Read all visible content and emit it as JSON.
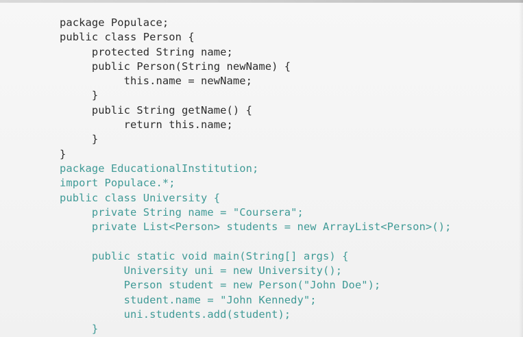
{
  "slide": {
    "code_lines": [
      {
        "text": "package Populace;",
        "color": "#2c2c2c"
      },
      {
        "text": "public class Person {",
        "color": "#2c2c2c"
      },
      {
        "text": "     protected String name;",
        "color": "#2c2c2c"
      },
      {
        "text": "     public Person(String newName) {",
        "color": "#2c2c2c"
      },
      {
        "text": "          this.name = newName;",
        "color": "#2c2c2c"
      },
      {
        "text": "     }",
        "color": "#2c2c2c"
      },
      {
        "text": "     public String getName() {",
        "color": "#2c2c2c"
      },
      {
        "text": "          return this.name;",
        "color": "#2c2c2c"
      },
      {
        "text": "     }",
        "color": "#2c2c2c"
      },
      {
        "text": "}",
        "color": "#2c2c2c"
      },
      {
        "text": "package EducationalInstitution;",
        "color": "#3f9a96"
      },
      {
        "text": "import Populace.*;",
        "color": "#3f9a96"
      },
      {
        "text": "public class University {",
        "color": "#3f9a96"
      },
      {
        "text": "     private String name = \"Coursera\";",
        "color": "#3f9a96"
      },
      {
        "text": "     private List<Person> students = new ArrayList<Person>();",
        "color": "#3f9a96"
      },
      {
        "text": "",
        "color": "#3f9a96"
      },
      {
        "text": "     public static void main(String[] args) {",
        "color": "#3f9a96"
      },
      {
        "text": "          University uni = new University();",
        "color": "#3f9a96"
      },
      {
        "text": "          Person student = new Person(\"John Doe\");",
        "color": "#3f9a96"
      },
      {
        "text": "          student.name = \"John Kennedy\";",
        "color": "#3f9a96"
      },
      {
        "text": "          uni.students.add(student);",
        "color": "#3f9a96"
      },
      {
        "text": "     }",
        "color": "#3f9a96"
      }
    ]
  }
}
